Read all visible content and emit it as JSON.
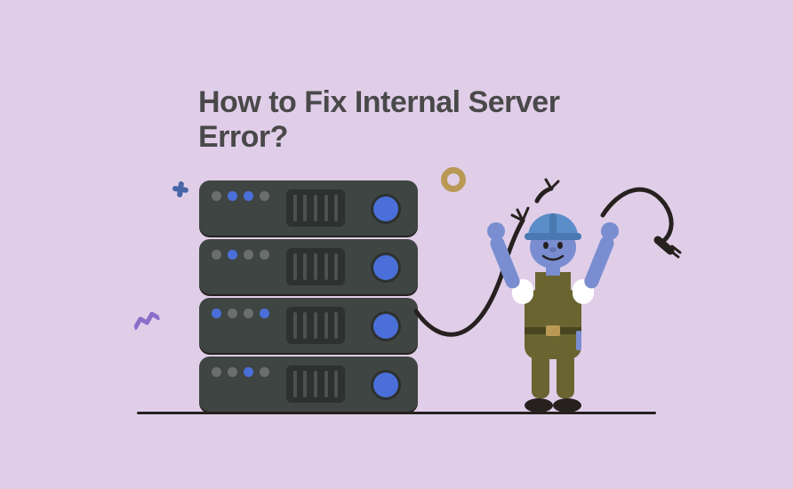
{
  "title": "How to Fix Internal Server Error?",
  "colors": {
    "background": "#e0cee9",
    "text": "#494949",
    "server_body": "#3f4542",
    "server_dark": "#2d312f",
    "accent_blue": "#4a6fd9",
    "accent_gold": "#b99954",
    "accent_purple": "#8a6fca",
    "ground": "#26211f",
    "character_skin": "#7a8dd0",
    "character_overalls": "#6a6430",
    "character_shirt": "#ffffff",
    "helmet": "#5b8ec8"
  },
  "decorations": {
    "circle": "gold-ring",
    "cross": "blue-plus",
    "bolt": "purple-zigzag"
  },
  "illustration": {
    "server_units": 4,
    "cables": 2,
    "cable_left_state": "broken-sparking",
    "cable_right_state": "unplugged-plug",
    "character_role": "technician",
    "character_helmet": true
  }
}
